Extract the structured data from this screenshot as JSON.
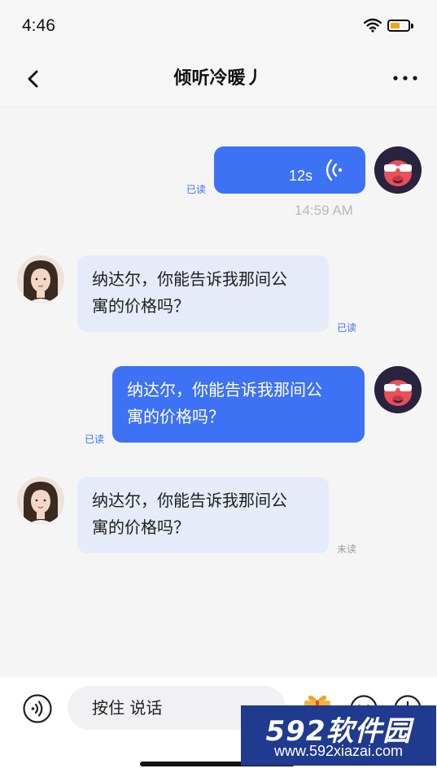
{
  "status_bar": {
    "time": "4:46",
    "wifi_icon": "wifi-icon",
    "battery_icon": "battery-icon",
    "battery_color": "#f0a51b"
  },
  "header": {
    "title": "倾听冷暖丿",
    "back_icon": "chevron-left-icon",
    "more_icon": "more-dots-icon"
  },
  "messages": [
    {
      "side": "out",
      "kind": "voice",
      "duration": "12s",
      "status": "已读",
      "icon": "voice-wave-icon"
    },
    {
      "kind": "timestamp",
      "text": "14:59 AM"
    },
    {
      "side": "in",
      "kind": "text",
      "text_line1": "纳达尔，你能告诉我那间公",
      "text_line2": "寓的价格吗？",
      "status": "已读"
    },
    {
      "side": "out",
      "kind": "text",
      "text_line1": "纳达尔，你能告诉我那间公",
      "text_line2": "寓的价格吗？",
      "status": "已读"
    },
    {
      "side": "in",
      "kind": "text",
      "text_line1": "纳达尔，你能告诉我那间公",
      "text_line2": "寓的价格吗？",
      "status": "未读"
    }
  ],
  "input_bar": {
    "voice_icon": "voice-input-icon",
    "hold_to_talk": "按住 说话",
    "gift_icon": "gift-icon",
    "emoji_icon": "emoji-icon",
    "plus_icon": "plus-icon"
  },
  "watermark": {
    "brand": "592软件园",
    "url": "www.592xiazai.com"
  },
  "colors": {
    "accent": "#3d72f4",
    "incoming_bubble": "#e6ebfa",
    "background": "#f5f5f6"
  }
}
